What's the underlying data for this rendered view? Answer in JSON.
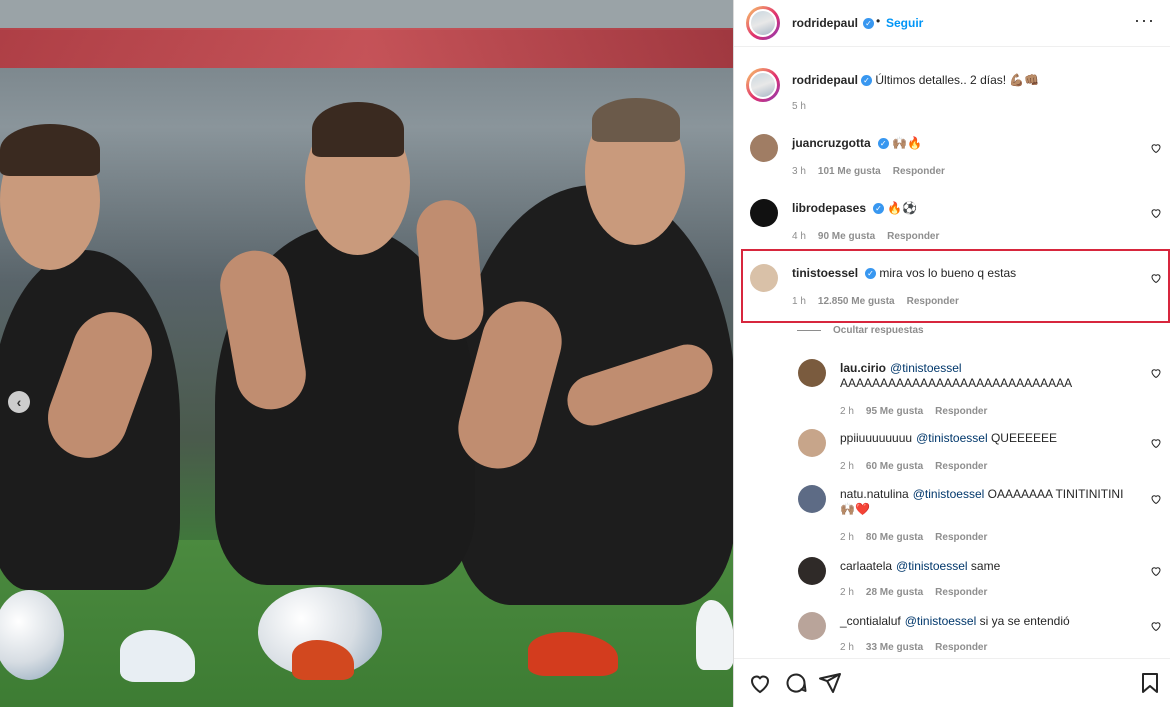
{
  "post": {
    "author": "rodridepaul",
    "follow_label": "Seguir",
    "separator": "•",
    "more_label": "···",
    "carousel_prev": "‹",
    "caption": "Últimos detalles.. 2 días! 💪🏽👊🏽",
    "caption_time": "5 h"
  },
  "comments": [
    {
      "user": "juancruzgotta",
      "verified": true,
      "text": "🙌🏽🔥",
      "time": "3 h",
      "likes": "101 Me gusta",
      "reply": "Responder",
      "avatar_color": "#a07d64"
    },
    {
      "user": "librodepases",
      "verified": true,
      "text": "🔥⚽️",
      "time": "4 h",
      "likes": "90 Me gusta",
      "reply": "Responder",
      "avatar_color": "#111111"
    },
    {
      "user": "tinistoessel",
      "verified": true,
      "text": "mira vos lo bueno q estas",
      "time": "1 h",
      "likes": "12.850 Me gusta",
      "reply": "Responder",
      "avatar_color": "#d9c1a8"
    }
  ],
  "hide_replies_label": "Ocultar respuestas",
  "replies": [
    {
      "user": "lau.cirio",
      "mention": "@tinistoessel",
      "text": "AAAAAAAAAAAAAAAAAAAAAAAAAAAAA",
      "time": "2 h",
      "likes": "95 Me gusta",
      "reply": "Responder",
      "avatar_color": "#7a5b3e"
    },
    {
      "user": "ppiiuuuuuuuu",
      "mention": "@tinistoessel",
      "text": "QUEEEEEE",
      "time": "2 h",
      "likes": "60 Me gusta",
      "reply": "Responder",
      "avatar_color": "#c7a58a"
    },
    {
      "user": "natu.natulina",
      "mention": "@tinistoessel",
      "text": "OAAAAAAA TINITINITINI",
      "text2": "🙌🏽❤️",
      "time": "2 h",
      "likes": "80 Me gusta",
      "reply": "Responder",
      "avatar_color": "#5d6b85"
    },
    {
      "user": "carlaatela",
      "mention": "@tinistoessel",
      "text": "same",
      "time": "2 h",
      "likes": "28 Me gusta",
      "reply": "Responder",
      "avatar_color": "#2f2a28"
    },
    {
      "user": "_contialaluf",
      "mention": "@tinistoessel",
      "text": "si ya se entendió",
      "time": "2 h",
      "likes": "33 Me gusta",
      "reply": "Responder",
      "avatar_color": "#b9a49a"
    }
  ],
  "icons": [
    "heart-icon",
    "comment-icon",
    "share-icon",
    "bookmark-icon"
  ]
}
